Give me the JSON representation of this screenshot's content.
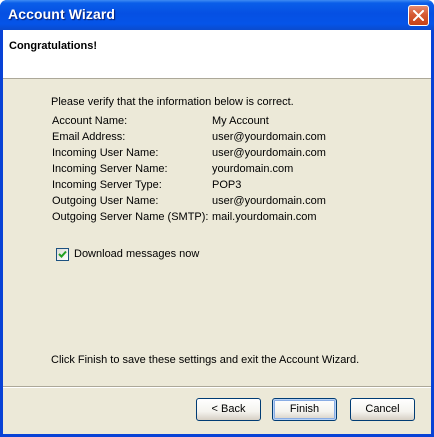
{
  "window": {
    "title": "Account Wizard",
    "close_icon": "close-icon"
  },
  "header": {
    "title": "Congratulations!"
  },
  "body": {
    "verify_text": "Please verify that the information below is correct.",
    "info": [
      {
        "label": "Account Name:",
        "value": "My Account"
      },
      {
        "label": "Email Address:",
        "value": "user@yourdomain.com"
      },
      {
        "label": "Incoming User Name:",
        "value": "user@yourdomain.com"
      },
      {
        "label": "Incoming Server Name:",
        "value": "yourdomain.com"
      },
      {
        "label": "Incoming Server Type:",
        "value": "POP3"
      },
      {
        "label": "Outgoing User Name:",
        "value": "user@yourdomain.com"
      },
      {
        "label": "Outgoing Server Name (SMTP):",
        "value": "mail.yourdomain.com"
      }
    ],
    "download_checkbox": {
      "label": "Download messages now",
      "checked": true
    },
    "finish_text": "Click Finish to save these settings and exit the Account Wizard."
  },
  "buttons": {
    "back": "< Back",
    "finish": "Finish",
    "cancel": "Cancel"
  },
  "colors": {
    "titlebar": "#0554e8",
    "dialog_bg": "#ece9d8",
    "close_button": "#d65a34"
  }
}
